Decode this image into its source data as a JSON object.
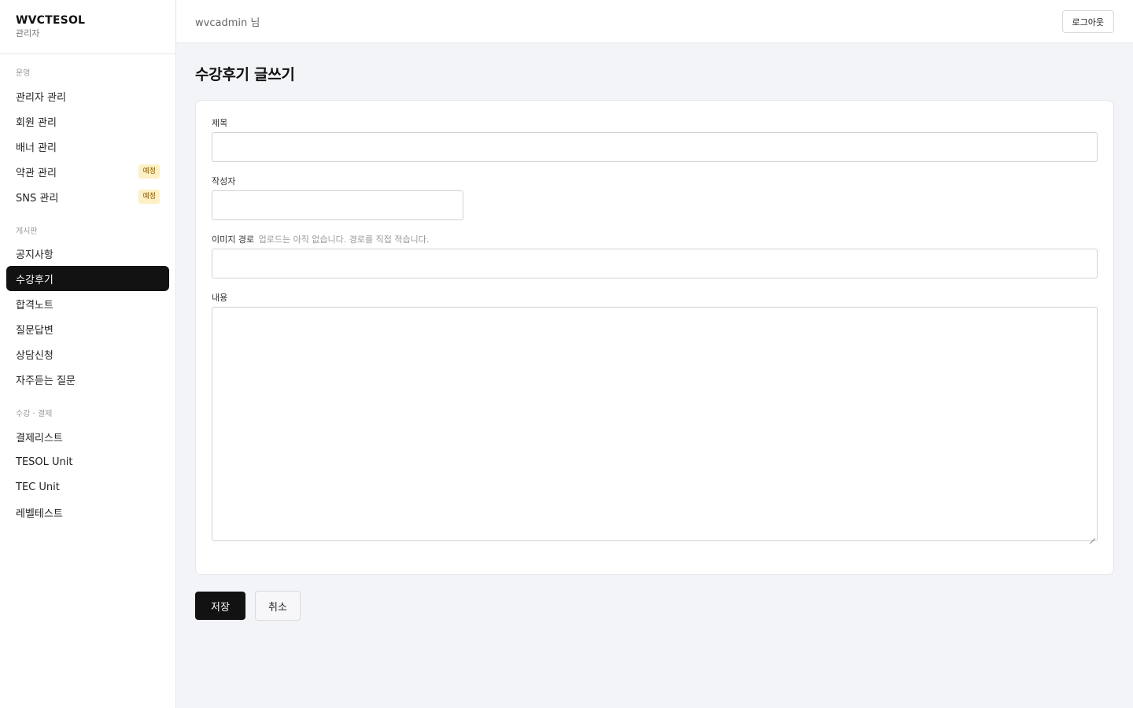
{
  "brand": {
    "title": "WVCTESOL",
    "subtitle": "관리자"
  },
  "topbar": {
    "user": "wvcadmin 님",
    "logout_label": "로그아웃"
  },
  "sidebar": {
    "sections": [
      {
        "label": "운영",
        "items": [
          {
            "label": "관리자 관리"
          },
          {
            "label": "회원 관리"
          },
          {
            "label": "배너 관리"
          },
          {
            "label": "약관 관리",
            "badge": "예정"
          },
          {
            "label": "SNS 관리",
            "badge": "예정"
          }
        ]
      },
      {
        "label": "게시판",
        "items": [
          {
            "label": "공지사항"
          },
          {
            "label": "수강후기",
            "active": true
          },
          {
            "label": "합격노트"
          },
          {
            "label": "질문답변"
          },
          {
            "label": "상담신청"
          },
          {
            "label": "자주듣는 질문"
          }
        ]
      },
      {
        "label": "수강 · 결제",
        "items": [
          {
            "label": "결제리스트"
          },
          {
            "label": "TESOL Unit"
          },
          {
            "label": "TEC Unit"
          },
          {
            "label": "레벨테스트"
          }
        ]
      }
    ]
  },
  "page": {
    "title": "수강후기 글쓰기"
  },
  "form": {
    "title_label": "제목",
    "title_value": "",
    "author_label": "작성자",
    "author_value": "",
    "image_label": "이미지 경로",
    "image_hint": "업로드는 아직 없습니다. 경로를 직접 적습니다.",
    "image_value": "",
    "content_label": "내용",
    "content_value": "",
    "save_label": "저장",
    "cancel_label": "취소"
  },
  "colors": {
    "active_nav_bg": "#121212",
    "badge_bg": "#fdf0c4",
    "badge_text": "#8a5a00",
    "page_bg": "#f3f4f8"
  }
}
